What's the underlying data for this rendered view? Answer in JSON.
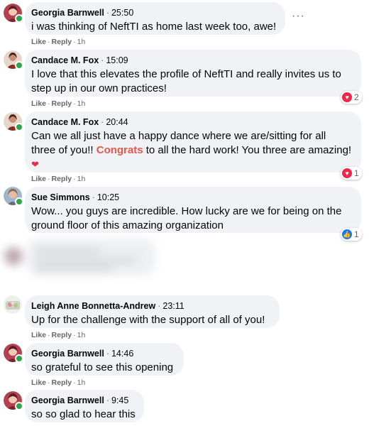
{
  "action_like": "Like",
  "action_reply": "Reply",
  "action_dot": "·",
  "more_label": "···",
  "comments": [
    {
      "author": "Georgia Barnwell",
      "time": "25:50",
      "text": "i was thinking of NeftTI as home last week too, awe!",
      "ago": "1h"
    },
    {
      "author": "Candace M. Fox",
      "time": "15:09",
      "text": "I love that this elevates the profile of NeftTI and really invites us to step up in our own practices!",
      "ago": "1h",
      "reaction_count": "2"
    },
    {
      "author": "Candace M. Fox",
      "time": "20:44",
      "text_before": "Can we all just have a happy dance where we are/sitting for all three of you!!",
      "highlight": "Congrats",
      "text_after": "to all the hard work! You three are amazing!",
      "ago": "1h",
      "reaction_count": "1"
    },
    {
      "author": "Sue Simmons",
      "time": "10:25",
      "text": "Wow... you guys are incredible. How lucky are we for being on the ground floor of this amazing organization",
      "reaction_count": "1"
    },
    {
      "author": "Leigh Anne Bonnetta-Andrew",
      "time": "23:11",
      "text": "Up for the challenge with the support of all of you!",
      "ago": "1h"
    },
    {
      "author": "Georgia Barnwell",
      "time": "14:46",
      "text": "so grateful to see this opening",
      "ago": "1h"
    },
    {
      "author": "Georgia Barnwell",
      "time": "9:45",
      "text": "so so glad to hear this"
    }
  ],
  "colors": {
    "bubble": "#f0f2f5",
    "highlight": "#e4594b",
    "online": "#31a24c",
    "love": "#f0284a",
    "like": "#1877f2"
  },
  "icons": {
    "love": "heart-icon",
    "like": "thumbs-up-icon",
    "online": "online-status-dot"
  }
}
